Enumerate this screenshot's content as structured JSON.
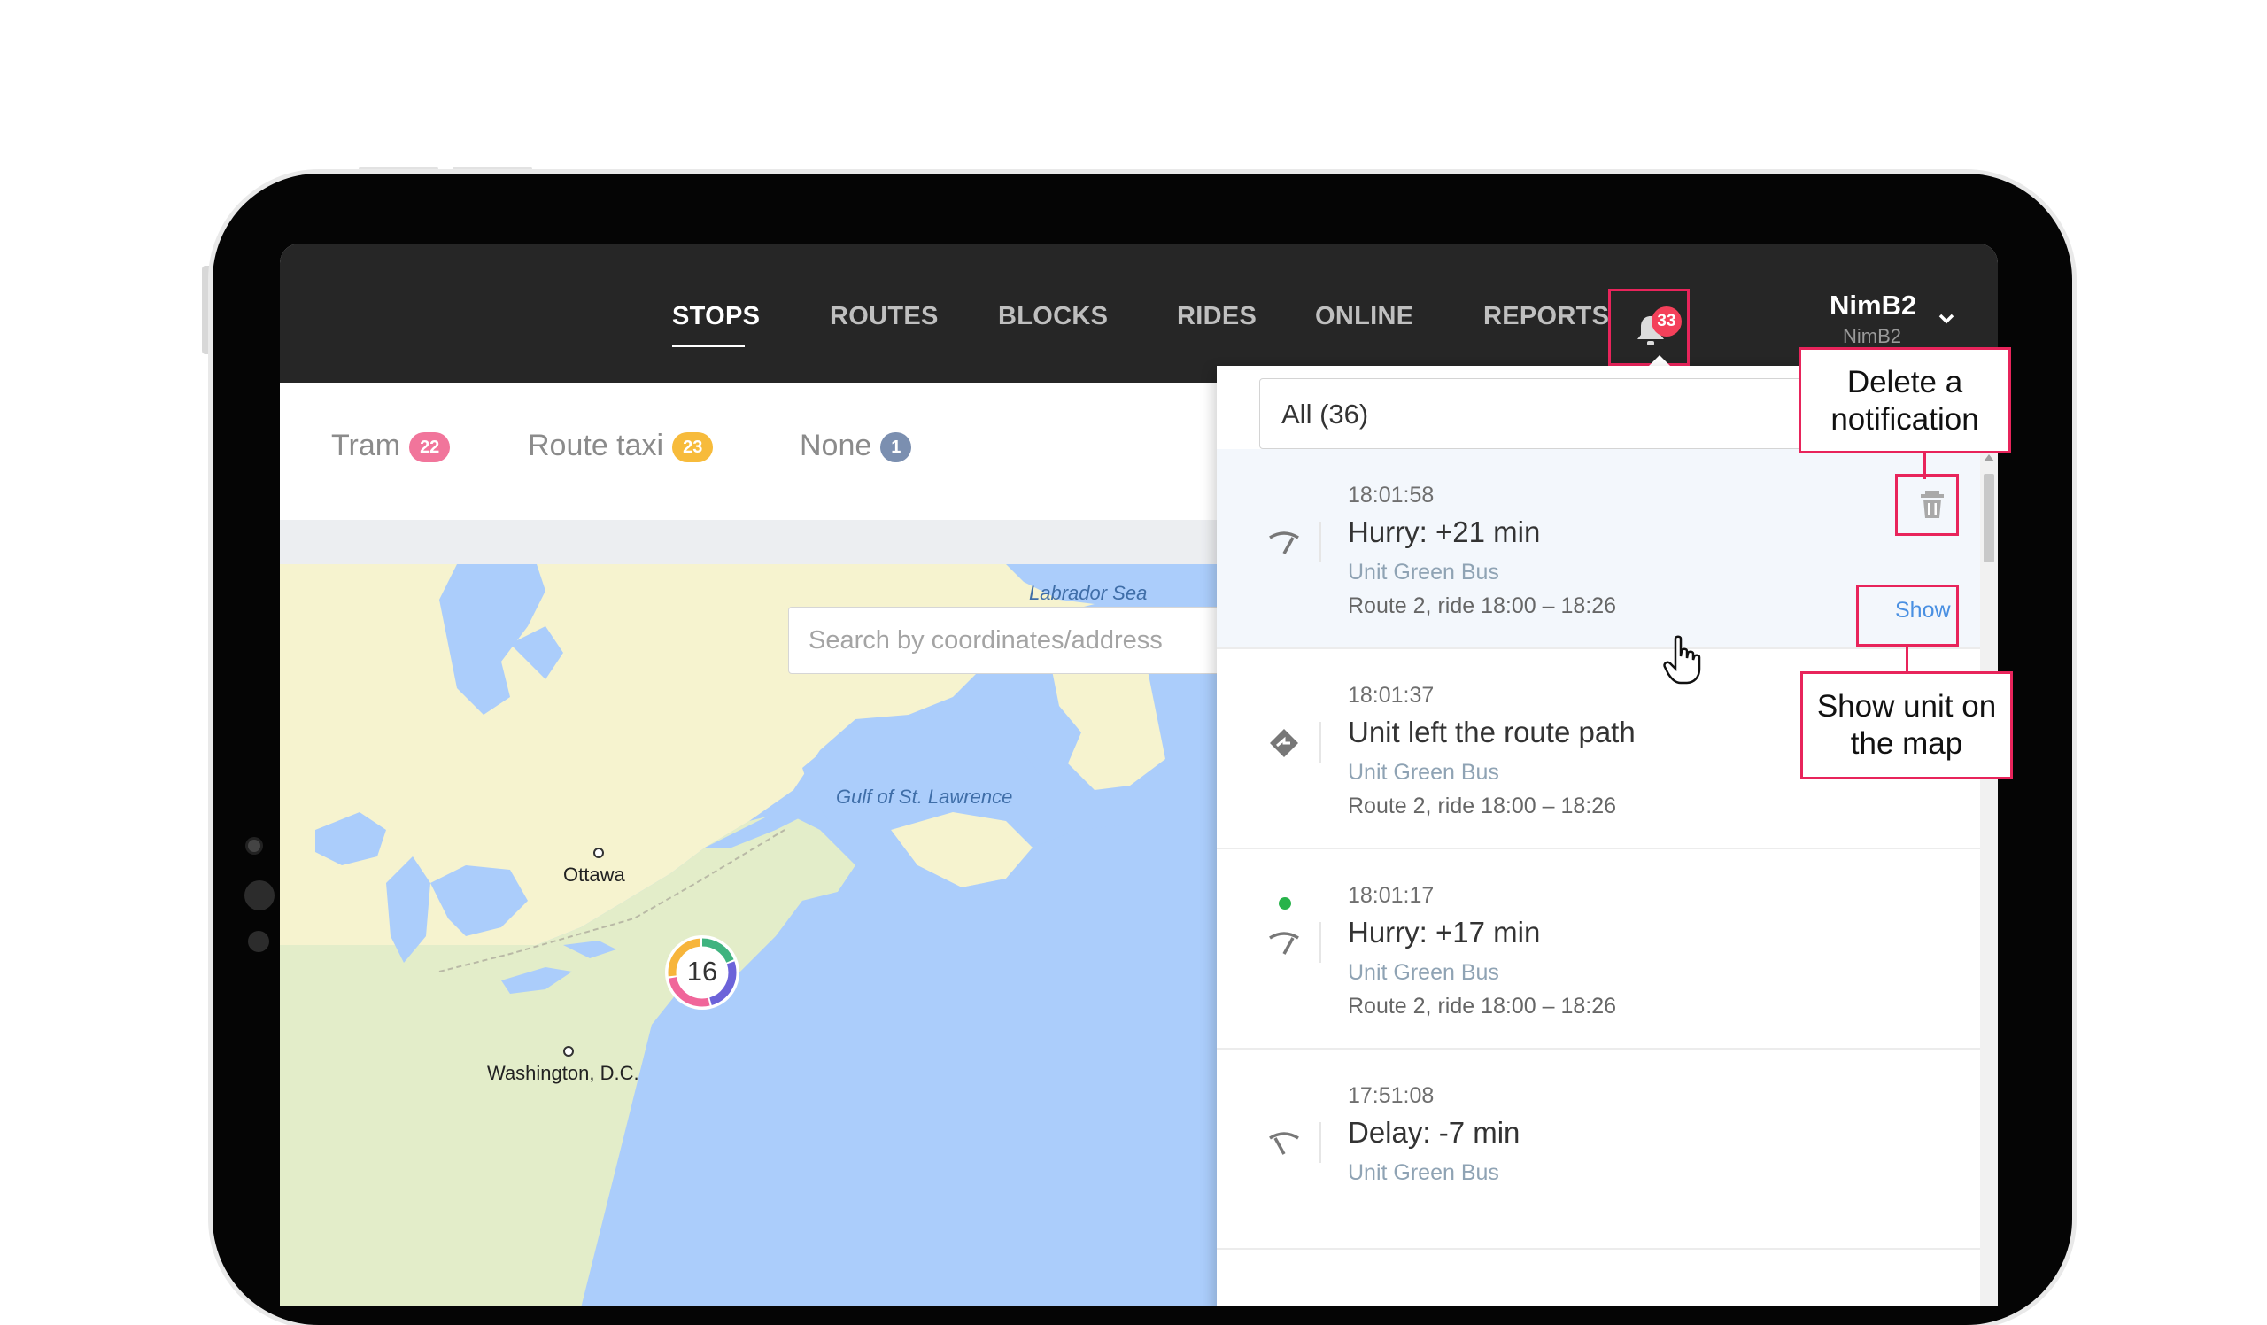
{
  "nav": {
    "items": [
      {
        "label": "STOPS",
        "active": true
      },
      {
        "label": "ROUTES",
        "active": false
      },
      {
        "label": "BLOCKS",
        "active": false
      },
      {
        "label": "RIDES",
        "active": false
      },
      {
        "label": "ONLINE",
        "active": false
      },
      {
        "label": "REPORTS",
        "active": false
      }
    ],
    "notification_count": "33",
    "user": {
      "name": "NimB2",
      "subname": "NimB2",
      "menu_icon": "chevron-down-icon"
    }
  },
  "filters": [
    {
      "label": "Tram",
      "count": "22",
      "color": "#f1759b"
    },
    {
      "label": "Route taxi",
      "count": "23",
      "color": "#f7bb3b"
    },
    {
      "label": "None",
      "count": "1",
      "color": "#7b8fb0"
    }
  ],
  "map": {
    "search_placeholder": "Search by coordinates/address",
    "labels": {
      "labrador_sea": "Labrador Sea",
      "gulf": "Gulf of St. Lawrence",
      "ottawa": "Ottawa",
      "washington": "Washington, D.C."
    },
    "cluster_count": "16",
    "colors": {
      "water": "#abcdfb",
      "land": "#f6f3cf",
      "land_us": "#e3edc9"
    }
  },
  "notifications_panel": {
    "filter_value": "All (36)",
    "items": [
      {
        "time": "18:01:58",
        "title": "Hurry: +21 min",
        "unit": "Unit Green Bus",
        "route": "Route 2, ride 18:00 – 18:26",
        "icon": "hurry-icon",
        "new": false,
        "show_label": "Show"
      },
      {
        "time": "18:01:37",
        "title": "Unit left the route path",
        "unit": "Unit Green Bus",
        "route": "Route 2, ride 18:00 – 18:26",
        "icon": "route-deviation-icon",
        "new": false
      },
      {
        "time": "18:01:17",
        "title": "Hurry: +17 min",
        "unit": "Unit Green Bus",
        "route": "Route 2, ride 18:00 – 18:26",
        "icon": "hurry-icon",
        "new": true
      },
      {
        "time": "17:51:08",
        "title": "Delay: -7 min",
        "unit": "Unit Green Bus",
        "route": "",
        "icon": "delay-icon",
        "new": false
      }
    ]
  },
  "callouts": {
    "delete": "Delete a notification",
    "show": "Show unit on the map"
  },
  "accent_color": "#e8245b"
}
